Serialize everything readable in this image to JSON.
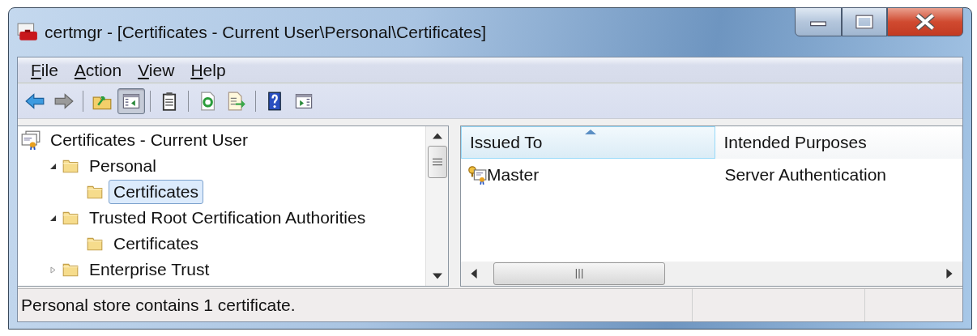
{
  "window": {
    "title": "certmgr - [Certificates - Current User\\Personal\\Certificates]"
  },
  "menu": [
    {
      "label": "File",
      "first_letter_underlined": true
    },
    {
      "label": "Action",
      "first_letter_underlined": true
    },
    {
      "label": "View",
      "first_letter_underlined": true
    },
    {
      "label": "Help",
      "first_letter_underlined": true
    }
  ],
  "toolbar": [
    {
      "kind": "back",
      "pressed": false
    },
    {
      "kind": "forward",
      "pressed": false
    },
    {
      "kind": "separator"
    },
    {
      "kind": "up",
      "pressed": false
    },
    {
      "kind": "tree",
      "pressed": true
    },
    {
      "kind": "separator"
    },
    {
      "kind": "properties",
      "pressed": false
    },
    {
      "kind": "separator"
    },
    {
      "kind": "refresh",
      "pressed": false
    },
    {
      "kind": "export",
      "pressed": false
    },
    {
      "kind": "separator"
    },
    {
      "kind": "help",
      "pressed": false
    },
    {
      "kind": "pane",
      "pressed": false
    }
  ],
  "tree": [
    {
      "label": "Certificates - Current User",
      "kind": "root",
      "selected": false,
      "children": [
        {
          "label": "Personal",
          "kind": "folder",
          "selected": false,
          "expanded": true,
          "children": [
            {
              "label": "Certificates",
              "kind": "folder",
              "selected": true
            }
          ]
        },
        {
          "label": "Trusted Root Certification Authorities",
          "kind": "folder",
          "selected": false,
          "expanded": true,
          "children": [
            {
              "label": "Certificates",
              "kind": "folder",
              "selected": false
            }
          ]
        },
        {
          "label": "Enterprise Trust",
          "kind": "folder",
          "selected": false,
          "expanded": false
        }
      ]
    }
  ],
  "table": {
    "columns": [
      {
        "label": "Issued To",
        "sorted": true
      },
      {
        "label": "Intended Purposes",
        "sorted": false
      }
    ],
    "rows": [
      {
        "cells": [
          "Master",
          "Server Authentication"
        ]
      }
    ]
  },
  "status_bar": {
    "text": "Personal store contains 1 certificate."
  }
}
